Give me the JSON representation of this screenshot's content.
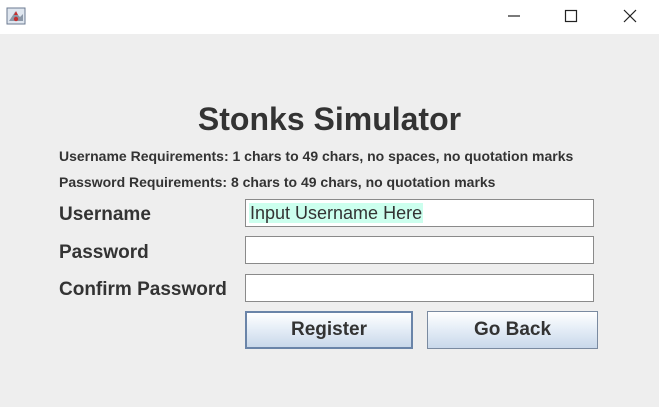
{
  "window": {
    "title_icon": "java-app-icon",
    "controls": [
      "minimize-icon",
      "maximize-icon",
      "close-icon"
    ]
  },
  "form": {
    "title": "Stonks Simulator",
    "username_requirements": "Username Requirements: 1 chars to 49 chars, no spaces, no quotation marks",
    "password_requirements": "Password Requirements: 8 chars to 49 chars, no quotation marks",
    "username_label": "Username",
    "username_value": "Input Username Here",
    "password_label": "Password",
    "password_value": "",
    "confirm_label": "Confirm Password",
    "confirm_value": "",
    "register_label": "Register",
    "back_label": "Go Back"
  },
  "colors": {
    "background": "#eeeeee",
    "text": "#333333",
    "username_highlight": "#ccffee"
  }
}
